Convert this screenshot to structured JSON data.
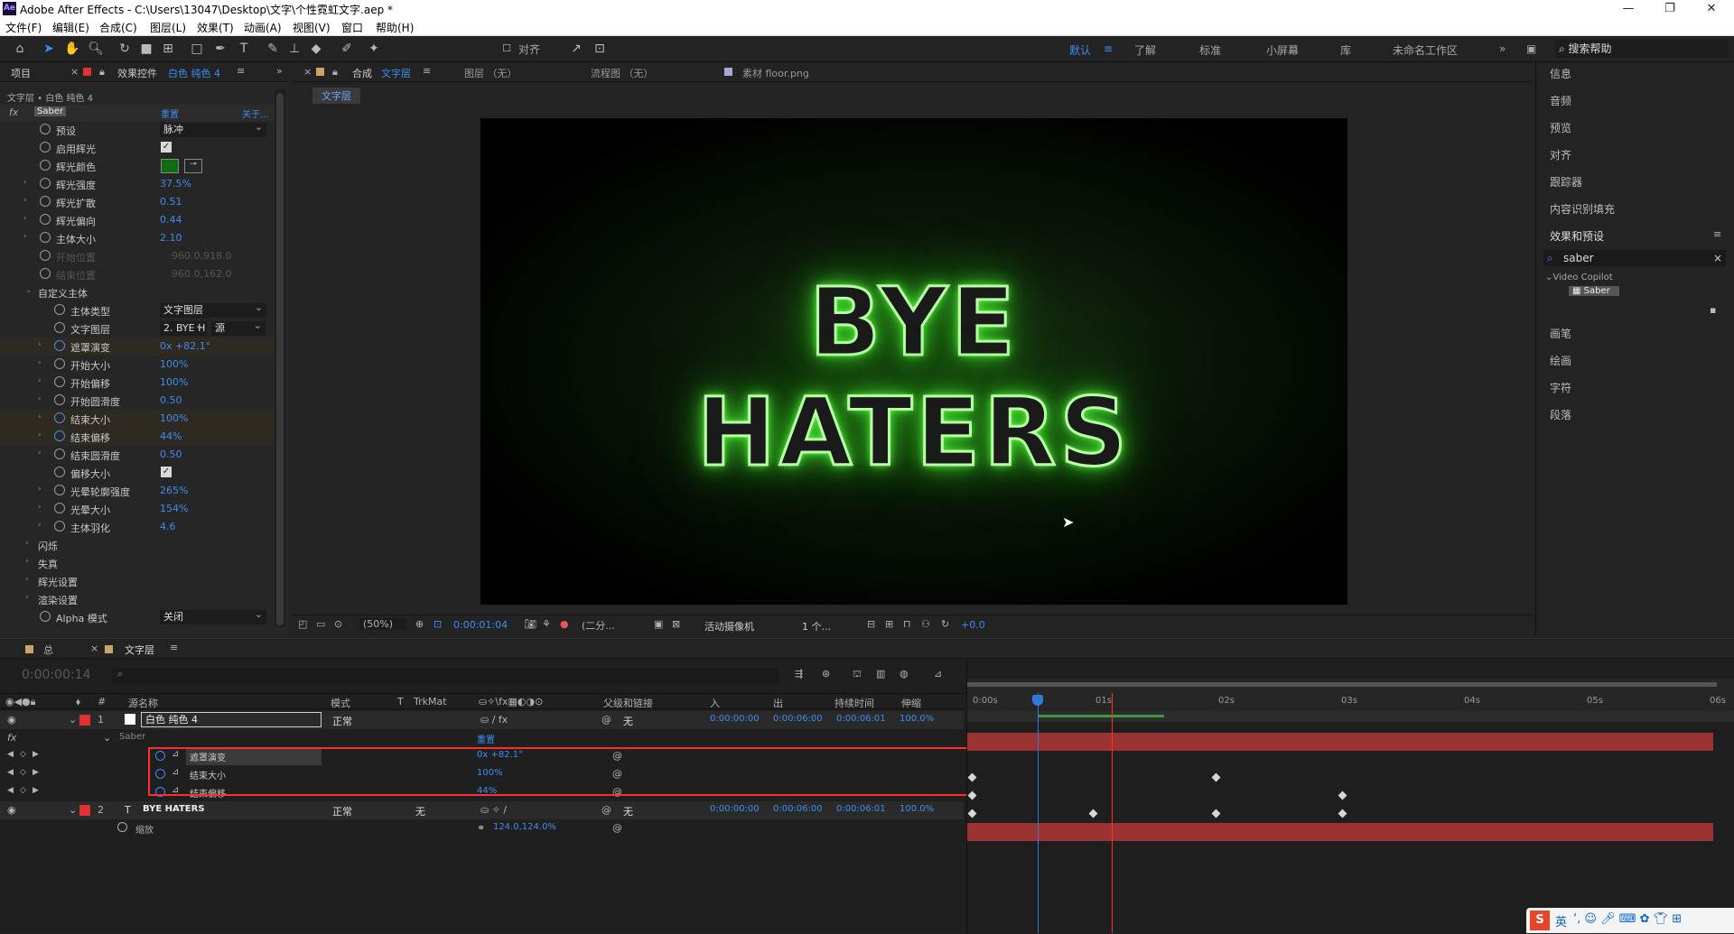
{
  "app": {
    "title": "Adobe After Effects - C:\\Users\\13047\\Desktop\\文字\\个性霓虹文字.aep *",
    "icon": "Ae"
  },
  "menu": [
    "文件(F)",
    "编辑(E)",
    "合成(C)",
    "图层(L)",
    "效果(T)",
    "动画(A)",
    "视图(V)",
    "窗口",
    "帮助(H)"
  ],
  "toolbar": {
    "align_label": "对齐",
    "workspaces": [
      "默认",
      "了解",
      "标准",
      "小屏幕",
      "库",
      "未命名工作区"
    ],
    "active_workspace": "默认",
    "search_help": "搜索帮助"
  },
  "left_panel": {
    "tab_project": "项目",
    "tab_effect_controls": "效果控件",
    "tab_layer_name": "白色 纯色 4",
    "breadcrumb": "文字层 • 白色 纯色 4",
    "effect_name": "Saber",
    "reset": "重置",
    "about": "关于...",
    "rows": [
      {
        "label": "预设",
        "type": "dropdown",
        "value": "脉冲"
      },
      {
        "label": "启用辉光",
        "type": "checkbox",
        "value": "✓"
      },
      {
        "label": "辉光颜色",
        "type": "color",
        "value": "#0f6b12"
      },
      {
        "label": "辉光强度",
        "type": "value",
        "value": "37.5%"
      },
      {
        "label": "辉光扩散",
        "type": "value",
        "value": "0.51"
      },
      {
        "label": "辉光偏向",
        "type": "value",
        "value": "0.44"
      },
      {
        "label": "主体大小",
        "type": "value",
        "value": "2.10"
      },
      {
        "label": "开始位置",
        "type": "disabled",
        "value": "960.0,918.0"
      },
      {
        "label": "结束位置",
        "type": "disabled",
        "value": "960.0,162.0"
      },
      {
        "label": "自定义主体",
        "type": "group",
        "value": ""
      },
      {
        "label": "主体类型",
        "type": "dropdown",
        "value": "文字图层"
      },
      {
        "label": "文字图层",
        "type": "dropdown2",
        "value": "2. BYE H",
        "value2": "源"
      },
      {
        "label": "遮罩演变",
        "type": "value",
        "value": "0x +82.1°"
      },
      {
        "label": "开始大小",
        "type": "value",
        "value": "100%"
      },
      {
        "label": "开始偏移",
        "type": "value",
        "value": "100%"
      },
      {
        "label": "开始圆滑度",
        "type": "value",
        "value": "0.50"
      },
      {
        "label": "结束大小",
        "type": "value",
        "value": "100%"
      },
      {
        "label": "结束偏移",
        "type": "value",
        "value": "44%"
      },
      {
        "label": "结束圆滑度",
        "type": "value",
        "value": "0.50"
      },
      {
        "label": "偏移大小",
        "type": "checkbox",
        "value": "✓"
      },
      {
        "label": "光晕轮廓强度",
        "type": "value",
        "value": "265%"
      },
      {
        "label": "光晕大小",
        "type": "value",
        "value": "154%"
      },
      {
        "label": "主体羽化",
        "type": "value",
        "value": "4.6"
      },
      {
        "label": "闪烁",
        "type": "group",
        "value": ""
      },
      {
        "label": "失真",
        "type": "group",
        "value": ""
      },
      {
        "label": "辉光设置",
        "type": "group",
        "value": ""
      },
      {
        "label": "渲染设置",
        "type": "group",
        "value": ""
      },
      {
        "label": "Alpha 模式",
        "type": "dropdown",
        "value": "关闭"
      }
    ]
  },
  "comp_panel": {
    "tab_comp_prefix": "合成",
    "tab_comp": "文字层",
    "tab_layer": "图层 （无）",
    "tab_flow": "流程图 （无）",
    "tab_footage": "素材 floor.png",
    "sub_tab": "文字层",
    "neon_text": "BYE HATERS",
    "zoom": "(50%)",
    "timecode": "0:00:01:04",
    "resolution": "(二分...",
    "camera": "活动摄像机",
    "views": "1 个...",
    "exposure": "+0.0"
  },
  "right_panel": {
    "items": [
      "信息",
      "音频",
      "预览",
      "对齐",
      "跟踪器",
      "内容识别填充",
      "效果和预设"
    ],
    "search_value": "saber",
    "tree_group": "Video Copilot",
    "tree_item": "Saber",
    "items2": [
      "画笔",
      "绘画",
      "字符",
      "段落"
    ]
  },
  "timeline": {
    "tab_total": "总",
    "tab_comp": "文字层",
    "timecode": "0:00:00:14",
    "search_placeholder": "",
    "headers": {
      "source": "源名称",
      "mode": "模式",
      "t": "T",
      "trkmat": "TrkMat",
      "parent": "父级和链接",
      "in": "入",
      "out": "出",
      "duration": "持续时间",
      "stretch": "伸缩",
      "num": "#"
    },
    "ruler": [
      "0:00s",
      "01s",
      "02s",
      "03s",
      "04s",
      "05s",
      "06s"
    ],
    "layers": [
      {
        "num": "1",
        "name": "白色 纯色 4",
        "mode": "正常",
        "parent": "无",
        "in": "0:00:00:00",
        "out": "0:00:06:00",
        "dur": "0:00:06:01",
        "stretch": "100.0%"
      },
      {
        "num": "2",
        "name": "BYE HATERS",
        "mode": "正常",
        "trkmat": "无",
        "parent": "无",
        "in": "0:00:00:00",
        "out": "0:00:06:00",
        "dur": "0:00:06:01",
        "stretch": "100.0%"
      }
    ],
    "fx_label": "Saber",
    "fx_reset": "重置",
    "props": [
      {
        "name": "遮罩演变",
        "value": "0x +82.1°"
      },
      {
        "name": "结束大小",
        "value": "100%"
      },
      {
        "name": "结束偏移",
        "value": "44%"
      }
    ],
    "scale_label": "缩放",
    "scale_value": "124.0,124.0%"
  },
  "tray": {
    "ime": "英"
  }
}
